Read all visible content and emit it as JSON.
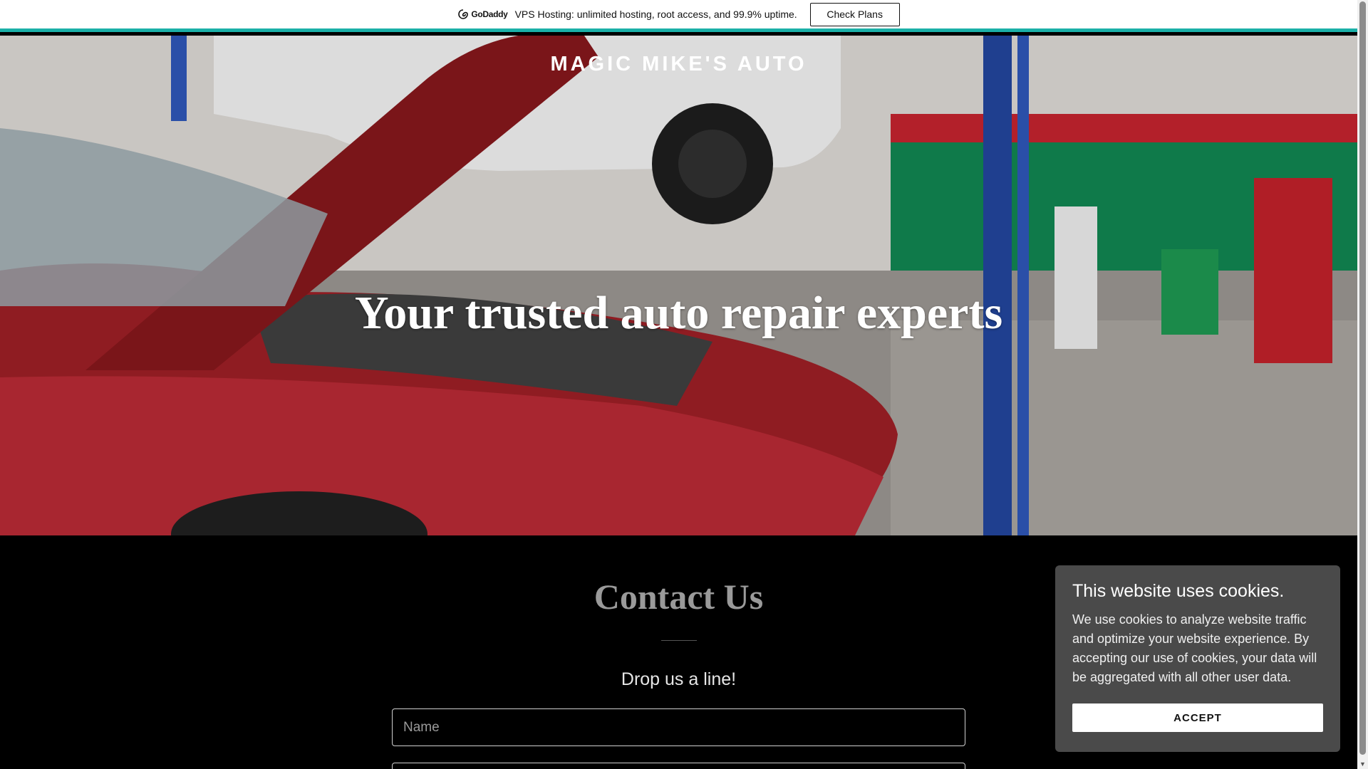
{
  "promo": {
    "logo_text": "GoDaddy",
    "message": "VPS Hosting: unlimited hosting, root access, and 99.9% uptime.",
    "cta_label": "Check Plans"
  },
  "hero": {
    "brand": "MAGIC MIKE'S AUTO",
    "headline": "Your trusted auto repair experts"
  },
  "contact": {
    "title": "Contact Us",
    "subtitle": "Drop us a line!",
    "name_placeholder": "Name",
    "email_placeholder": ""
  },
  "cookie": {
    "title": "This website uses cookies.",
    "body": "We use cookies to analyze website traffic and optimize your website experience. By accepting our use of cookies, your data will be aggregated with all other user data.",
    "accept_label": "ACCEPT"
  },
  "colors": {
    "promo_accent": "#1bb0a8",
    "cookie_bg": "#4a4a4a",
    "page_bg": "#000000"
  }
}
